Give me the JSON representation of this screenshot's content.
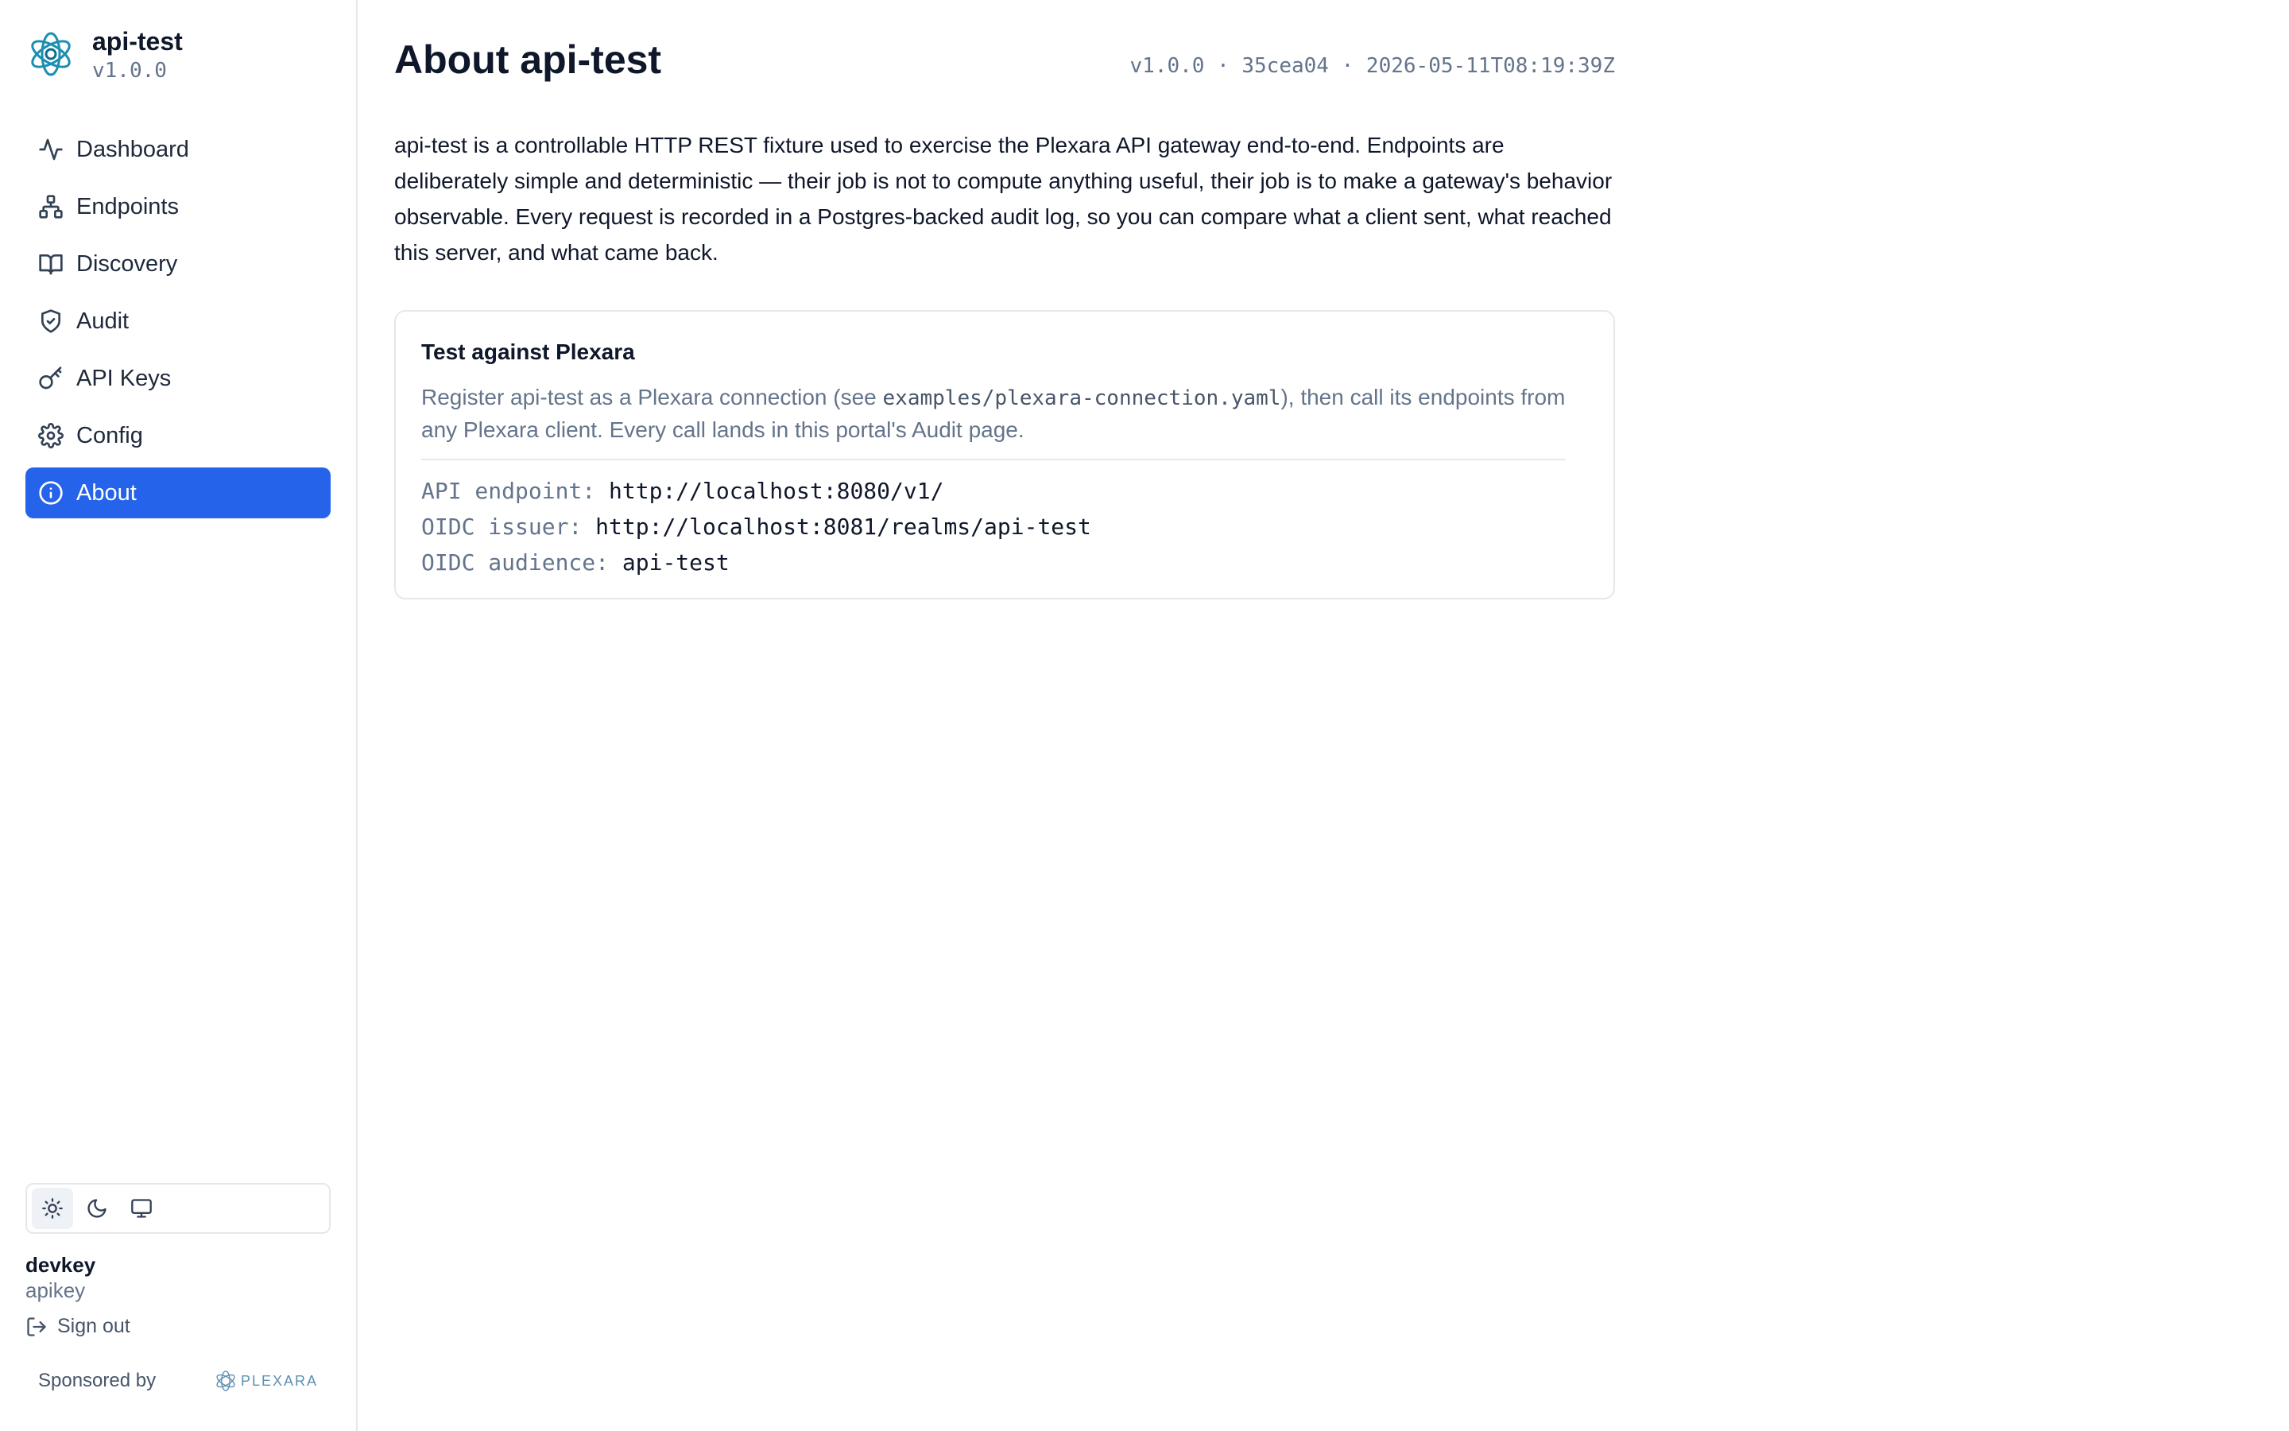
{
  "brand": {
    "name": "api-test",
    "version": "v1.0.0"
  },
  "nav": [
    {
      "label": "Dashboard",
      "icon": "activity-icon",
      "active": false
    },
    {
      "label": "Endpoints",
      "icon": "network-icon",
      "active": false
    },
    {
      "label": "Discovery",
      "icon": "book-icon",
      "active": false
    },
    {
      "label": "Audit",
      "icon": "shield-check-icon",
      "active": false
    },
    {
      "label": "API Keys",
      "icon": "key-icon",
      "active": false
    },
    {
      "label": "Config",
      "icon": "gear-icon",
      "active": false
    },
    {
      "label": "About",
      "icon": "info-icon",
      "active": true
    }
  ],
  "theme": {
    "options": [
      "sun-icon",
      "moon-icon",
      "monitor-icon"
    ],
    "selected": "sun-icon"
  },
  "user": {
    "name": "devkey",
    "type": "apikey",
    "signout_label": "Sign out"
  },
  "sponsor": {
    "label": "Sponsored by",
    "logo_text": "PLEXARA"
  },
  "page": {
    "title": "About api-test",
    "build": {
      "version": "v1.0.0",
      "separator": "·",
      "commit": "35cea04",
      "timestamp": "2026-05-11T08:19:39Z"
    },
    "description": "api-test is a controllable HTTP REST fixture used to exercise the Plexara API gateway end-to-end. Endpoints are deliberately simple and deterministic — their job is not to compute anything useful, their job is to make a gateway's behavior observable. Every request is recorded in a Postgres-backed audit log, so you can compare what a client sent, what reached this server, and what came back.",
    "card": {
      "title": "Test against Plexara",
      "text_before": "Register api-test as a Plexara connection (see ",
      "text_code": "examples/plexara-connection.yaml",
      "text_after": "), then call its endpoints from any Plexara client. Every call lands in this portal's Audit page.",
      "rows": [
        {
          "key": "API endpoint:",
          "value": "http://localhost:8080/v1/"
        },
        {
          "key": "OIDC issuer:",
          "value": "http://localhost:8081/realms/api-test"
        },
        {
          "key": "OIDC audience:",
          "value": "api-test"
        }
      ]
    }
  },
  "colors": {
    "accent": "#2563eb",
    "muted": "#64748b",
    "border": "#e5e7eb",
    "brand_logo": "#1b8fb0"
  }
}
